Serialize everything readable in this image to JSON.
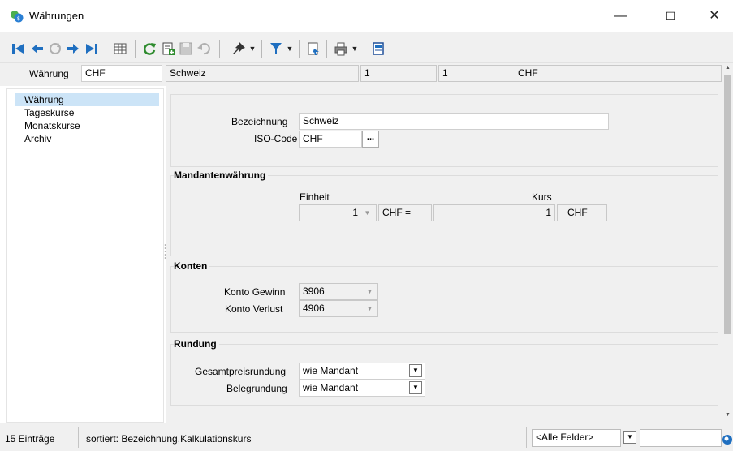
{
  "window": {
    "title": "Währungen",
    "minimize": "—",
    "maximize": "☐",
    "close": "✕"
  },
  "toolbar": {
    "icons": [
      "first-record-icon",
      "prev-record-icon",
      "refresh-disabled-icon",
      "next-record-icon",
      "last-record-icon",
      "table-view-icon",
      "reload-icon",
      "new-record-icon",
      "save-icon",
      "undo-icon",
      "pin-icon",
      "filter-icon",
      "export-icon",
      "print-icon",
      "form-icon"
    ]
  },
  "header": {
    "label": "Währung",
    "code": "CHF",
    "name": "Schweiz",
    "col3": "1",
    "col4": "1",
    "col5": "CHF"
  },
  "nav": {
    "items": [
      {
        "label": "Währung",
        "selected": true
      },
      {
        "label": "Tageskurse"
      },
      {
        "label": "Monatskurse"
      },
      {
        "label": "Archiv"
      }
    ]
  },
  "general": {
    "bezeichnung_label": "Bezeichnung",
    "bezeichnung_value": "Schweiz",
    "iso_label": "ISO-Code",
    "iso_value": "CHF",
    "iso_button": "..."
  },
  "mandanten": {
    "title": "Mandantenwährung",
    "einheit_label": "Einheit",
    "einheit_value": "1",
    "eq_text": "CHF =",
    "kurs_label": "Kurs",
    "kurs_value": "1",
    "kurs_currency": "CHF"
  },
  "konten": {
    "title": "Konten",
    "gewinn_label": "Konto Gewinn",
    "gewinn_value": "3906",
    "verlust_label": "Konto Verlust",
    "verlust_value": "4906"
  },
  "rundung": {
    "title": "Rundung",
    "gesamt_label": "Gesamtpreisrundung",
    "gesamt_value": "wie Mandant",
    "beleg_label": "Belegrundung",
    "beleg_value": "wie Mandant"
  },
  "status": {
    "count": "15 Einträge",
    "sort": "sortiert: Bezeichnung,Kalkulationskurs",
    "field_filter": "<Alle Felder>"
  }
}
